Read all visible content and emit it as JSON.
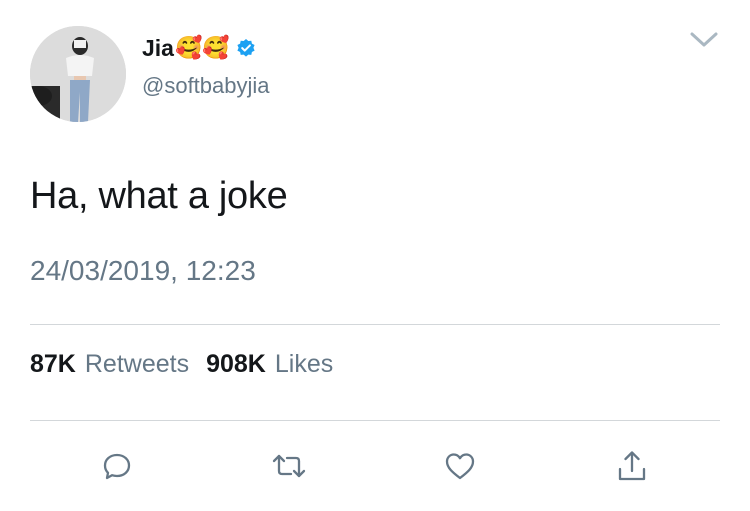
{
  "user": {
    "display_name": "Jia",
    "name_emoji": "🥰🥰",
    "handle": "@softbabyjia",
    "verified": true
  },
  "tweet": {
    "text": "Ha, what a joke",
    "timestamp": "24/03/2019, 12:23"
  },
  "stats": {
    "retweets_count": "87K",
    "retweets_label": "Retweets",
    "likes_count": "908K",
    "likes_label": "Likes"
  },
  "icons": {
    "menu": "chevron-down-icon",
    "reply": "reply-icon",
    "retweet": "retweet-icon",
    "like": "heart-icon",
    "share": "share-icon",
    "verified": "verified-badge-icon"
  },
  "colors": {
    "text_primary": "#14171a",
    "text_secondary": "#657786",
    "verified_blue": "#1da1f2",
    "divider": "#d3d7da"
  }
}
